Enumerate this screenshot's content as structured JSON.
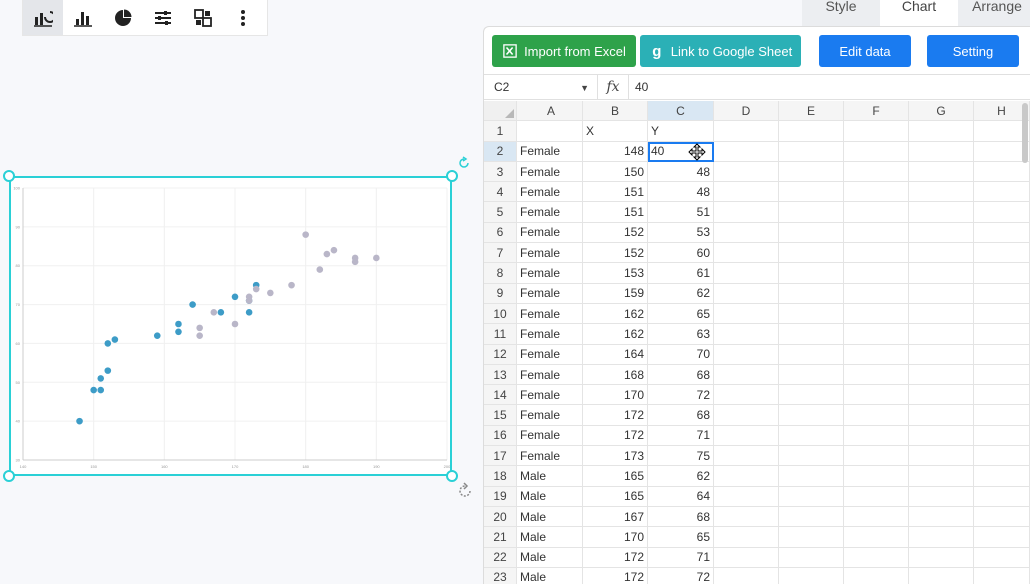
{
  "toolbar": {
    "icons": [
      "chart-type-icon",
      "bar-chart-icon",
      "pie-chart-icon",
      "sliders-icon",
      "replace-icon",
      "more-vertical-icon"
    ]
  },
  "panel_tabs": [
    "Style",
    "Chart",
    "Arrange"
  ],
  "actions": {
    "import_excel": "Import from Excel",
    "link_google": "Link to Google Sheet",
    "edit_data": "Edit data",
    "setting": "Setting"
  },
  "formula_bar": {
    "cell_ref": "C2",
    "fx": "fx",
    "value": "40"
  },
  "grid": {
    "columns": [
      "A",
      "B",
      "C",
      "D",
      "E",
      "F",
      "G",
      "H"
    ],
    "rows": [
      {
        "n": "1",
        "a": "",
        "b": "X",
        "c": "Y"
      },
      {
        "n": "2",
        "a": "Female",
        "b": "148",
        "c": "40"
      },
      {
        "n": "3",
        "a": "Female",
        "b": "150",
        "c": "48"
      },
      {
        "n": "4",
        "a": "Female",
        "b": "151",
        "c": "48"
      },
      {
        "n": "5",
        "a": "Female",
        "b": "151",
        "c": "51"
      },
      {
        "n": "6",
        "a": "Female",
        "b": "152",
        "c": "53"
      },
      {
        "n": "7",
        "a": "Female",
        "b": "152",
        "c": "60"
      },
      {
        "n": "8",
        "a": "Female",
        "b": "153",
        "c": "61"
      },
      {
        "n": "9",
        "a": "Female",
        "b": "159",
        "c": "62"
      },
      {
        "n": "10",
        "a": "Female",
        "b": "162",
        "c": "65"
      },
      {
        "n": "11",
        "a": "Female",
        "b": "162",
        "c": "63"
      },
      {
        "n": "12",
        "a": "Female",
        "b": "164",
        "c": "70"
      },
      {
        "n": "13",
        "a": "Female",
        "b": "168",
        "c": "68"
      },
      {
        "n": "14",
        "a": "Female",
        "b": "170",
        "c": "72"
      },
      {
        "n": "15",
        "a": "Female",
        "b": "172",
        "c": "68"
      },
      {
        "n": "16",
        "a": "Female",
        "b": "172",
        "c": "71"
      },
      {
        "n": "17",
        "a": "Female",
        "b": "173",
        "c": "75"
      },
      {
        "n": "18",
        "a": "Male",
        "b": "165",
        "c": "62"
      },
      {
        "n": "19",
        "a": "Male",
        "b": "165",
        "c": "64"
      },
      {
        "n": "20",
        "a": "Male",
        "b": "167",
        "c": "68"
      },
      {
        "n": "21",
        "a": "Male",
        "b": "170",
        "c": "65"
      },
      {
        "n": "22",
        "a": "Male",
        "b": "172",
        "c": "71"
      },
      {
        "n": "23",
        "a": "Male",
        "b": "172",
        "c": "72"
      }
    ]
  },
  "chart_data": {
    "type": "scatter",
    "series": [
      {
        "name": "Female",
        "color": "#3d9cc7",
        "points": [
          [
            148,
            40
          ],
          [
            150,
            48
          ],
          [
            151,
            48
          ],
          [
            151,
            51
          ],
          [
            152,
            53
          ],
          [
            152,
            60
          ],
          [
            153,
            61
          ],
          [
            159,
            62
          ],
          [
            162,
            65
          ],
          [
            162,
            63
          ],
          [
            164,
            70
          ],
          [
            168,
            68
          ],
          [
            170,
            72
          ],
          [
            172,
            68
          ],
          [
            172,
            71
          ],
          [
            173,
            75
          ]
        ]
      },
      {
        "name": "Male",
        "color": "#b9b6c8",
        "points": [
          [
            165,
            62
          ],
          [
            165,
            64
          ],
          [
            167,
            68
          ],
          [
            170,
            65
          ],
          [
            172,
            71
          ],
          [
            172,
            72
          ],
          [
            173,
            74
          ],
          [
            175,
            73
          ],
          [
            178,
            75
          ],
          [
            180,
            88
          ],
          [
            182,
            79
          ],
          [
            183,
            83
          ],
          [
            184,
            84
          ],
          [
            187,
            82
          ],
          [
            187,
            81
          ],
          [
            190,
            82
          ]
        ]
      }
    ],
    "xlim": [
      140,
      200
    ],
    "ylim": [
      30,
      100
    ],
    "grid": true,
    "legend": "bottom"
  }
}
